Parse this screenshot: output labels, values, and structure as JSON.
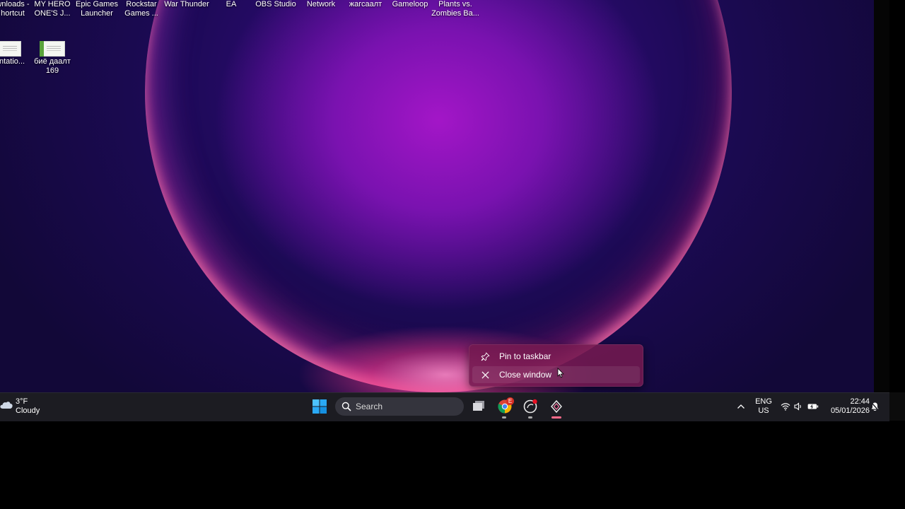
{
  "desktop": {
    "icons": [
      {
        "label": "wnloads -\nhortcut"
      },
      {
        "label": "MY HERO\nONE'S J..."
      },
      {
        "label": "Epic Games\nLauncher"
      },
      {
        "label": "Rockstar\nGames ..."
      },
      {
        "label": "War Thunder"
      },
      {
        "label": "EA"
      },
      {
        "label": "OBS Studio"
      },
      {
        "label": "Network"
      },
      {
        "label": "жагсаалт"
      },
      {
        "label": "Gameloop"
      },
      {
        "label": "Plants vs.\nZombies Ba..."
      }
    ],
    "files": [
      {
        "label": "entatio..."
      },
      {
        "label": "биё даалт\n169"
      }
    ]
  },
  "context_menu": {
    "items": [
      {
        "label": "Pin to taskbar",
        "icon": "pin-icon"
      },
      {
        "label": "Close window",
        "icon": "close-icon"
      }
    ]
  },
  "taskbar": {
    "weather": {
      "temp": "3°F",
      "condition": "Cloudy",
      "icon": "cloud-icon"
    },
    "search_placeholder": "Search",
    "apps": [
      {
        "name": "task-view",
        "icon": "task-view-icon"
      },
      {
        "name": "chrome",
        "icon": "chrome-icon",
        "badge": "E"
      },
      {
        "name": "app-notify",
        "icon": "circle-app-icon"
      },
      {
        "name": "active-app",
        "icon": "diamond-app-icon"
      }
    ],
    "tray": {
      "language_line1": "ENG",
      "language_line2": "US",
      "time": "22:44",
      "date": "05/01/2026"
    }
  },
  "colors": {
    "taskbar_bg": "#1c1c22",
    "menu_bg": "#731950",
    "active_indicator": "#ff6b8a"
  }
}
